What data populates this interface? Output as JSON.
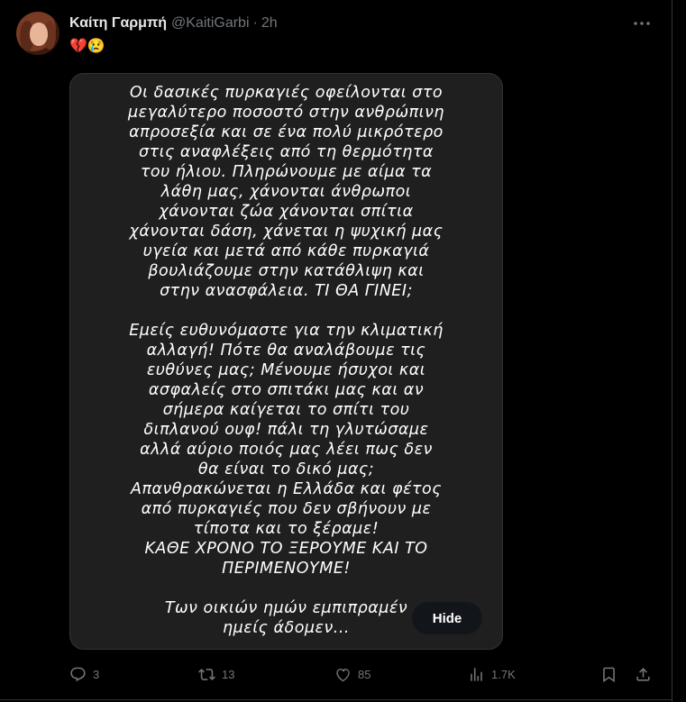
{
  "tweet": {
    "author_name": "Καίτη Γαρμπή",
    "author_handle": "@KaitiGarbi",
    "separator": "·",
    "time": "2h",
    "emoji_text": "💔😢",
    "story_lines": [
      "Οι δασικές πυρκαγιές οφείλονται στο",
      "μεγαλύτερο ποσοστό στην ανθρώπινη",
      "απροσεξία και σε ένα πολύ μικρότερο",
      "στις αναφλέξεις από τη θερμότητα",
      "του ήλιου. Πληρώνουμε με αίμα τα",
      "λάθη μας, χάνονται άνθρωποι",
      "χάνονται ζώα χάνονται σπίτια",
      "χάνονται δάση, χάνεται η ψυχική μας",
      "υγεία και μετά από κάθε πυρκαγιά",
      "βουλιάζουμε στην κατάθλιψη και",
      "στην ανασφάλεια. ΤΙ ΘΑ ΓΙΝΕΙ;",
      "",
      "Εμείς ευθυνόμαστε για την κλιματική",
      "αλλαγή! Πότε θα αναλάβουμε τις",
      "ευθύνες μας; Μένουμε ήσυχοι και",
      "ασφαλείς στο σπιτάκι μας και αν",
      "σήμερα καίγεται το σπίτι του",
      "διπλανού ουφ! πάλι τη γλυτώσαμε",
      "αλλά αύριο ποιός μας λέει πως δεν",
      "θα είναι το δικό μας;",
      "Απανθρακώνεται η Ελλάδα και φέτος",
      "από πυρκαγιές που δεν σβήνουν με",
      "τίποτα και το ξέραμε!",
      "ΚΑΘΕ ΧΡΟΝΟ ΤΟ ΞΕΡΟΥΜΕ ΚΑΙ ΤΟ",
      "ΠΕΡΙΜΕΝΟΥΜΕ!",
      "",
      "Των οικιών ημών εμπιπραμέν",
      "ημείς άδομεν..."
    ],
    "hide_label": "Hide",
    "replies": "3",
    "reposts": "13",
    "likes": "85",
    "views": "1.7K"
  },
  "icons": {
    "more": "more-horizontal-icon",
    "reply": "reply-icon",
    "repost": "repost-icon",
    "like": "heart-icon",
    "views": "views-chart-icon",
    "bookmark": "bookmark-icon",
    "share": "share-icon"
  }
}
